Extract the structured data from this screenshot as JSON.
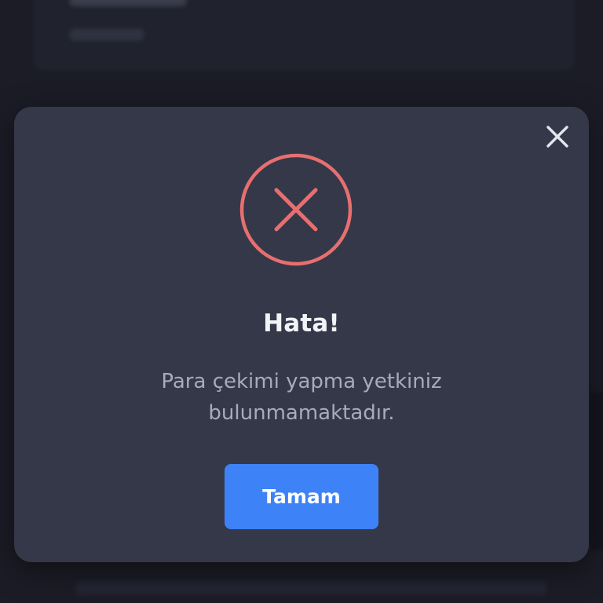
{
  "background": {
    "color": "#1b1c26"
  },
  "modal": {
    "background_color": "#353849",
    "close_icon": "close-icon",
    "status_icon": "error-circle-x-icon",
    "status_color": "#e86f6f",
    "title": "Hata!",
    "message": "Para çekimi yapma yetkiniz bulunmamaktadır.",
    "confirm_button": {
      "label": "Tamam",
      "color": "#3e82f7"
    }
  }
}
